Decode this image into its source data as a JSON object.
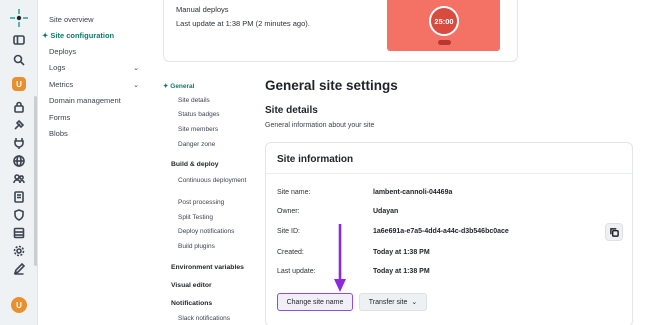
{
  "rail": {
    "icons": [
      "netlify-logo",
      "sidebar-toggle-icon",
      "search-icon",
      "team-avatar",
      "lock-icon",
      "build-icon",
      "plug-icon",
      "globe-icon",
      "users-icon",
      "document-icon",
      "shield-icon",
      "table-icon",
      "gear-icon",
      "pen-icon"
    ],
    "team_avatar_letter": "U",
    "user_avatar_letter": "U"
  },
  "sitenav": {
    "items": [
      {
        "label": "Site overview",
        "expandable": false
      },
      {
        "label": "Site configuration",
        "active": true,
        "expandable": false
      },
      {
        "label": "Deploys",
        "expandable": false
      },
      {
        "label": "Logs",
        "expandable": true
      },
      {
        "label": "Metrics",
        "expandable": true
      },
      {
        "label": "Domain management",
        "expandable": false
      },
      {
        "label": "Forms",
        "expandable": false
      },
      {
        "label": "Blobs",
        "expandable": false
      }
    ]
  },
  "topcard": {
    "line1": "Manual deploys",
    "line2": "Last update at 1:38 PM (2 minutes ago).",
    "timer": "25:00"
  },
  "subnav": {
    "general": "General",
    "general_items": [
      "Site details",
      "Status badges",
      "Site members",
      "Danger zone"
    ],
    "build_deploy": "Build & deploy",
    "build_items": [
      "Continuous deployment",
      "Post processing",
      "Split Testing",
      "Deploy notifications",
      "Build plugins"
    ],
    "env": "Environment variables",
    "visual": "Visual editor",
    "notifications": "Notifications",
    "notif_items": [
      "Slack notifications"
    ]
  },
  "main": {
    "title": "General site settings",
    "section": "Site details",
    "section_desc": "General information about your site",
    "card_title": "Site information",
    "rows": [
      {
        "label": "Site name:",
        "value": "lambent-cannoli-04469a"
      },
      {
        "label": "Owner:",
        "value": "Udayan"
      },
      {
        "label": "Site ID:",
        "value": "1a6e691a-e7a5-4dd4-a44c-d3b546bc0ace"
      },
      {
        "label": "Created:",
        "value": "Today at 1:38 PM"
      },
      {
        "label": "Last update:",
        "value": "Today at 1:38 PM"
      }
    ],
    "change_button": "Change site name",
    "transfer_button": "Transfer site"
  },
  "colors": {
    "accent": "#0f7a6a",
    "timer_bg": "#f47265",
    "highlight": "#8d4fe0"
  }
}
